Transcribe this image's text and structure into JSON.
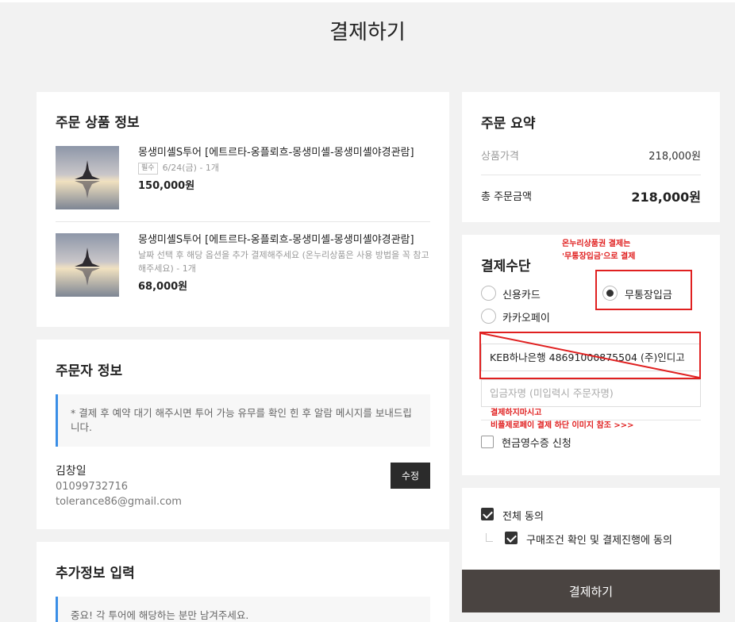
{
  "page_title": "결제하기",
  "products_card": {
    "title": "주문 상품 정보",
    "items": [
      {
        "name": "몽생미셸S투어 [에트르타-옹플뢰흐-몽생미셸-몽생미셸야경관람]",
        "badge": "필수",
        "meta": "6/24(금) - 1개",
        "price": "150,000원"
      },
      {
        "name": "몽생미셸S투어 [에트르타-옹플뢰흐-몽생미셸-몽생미셸야경관람]",
        "meta": "날짜 선택 후 해당 옵션을 추가 결제해주세요 (온누리상품은 사용 방법을 꼭 참고해주세요) - 1개",
        "price": "68,000원"
      }
    ]
  },
  "orderer_card": {
    "title": "주문자 정보",
    "notice": "* 결제 후 예약 대기 해주시면 투어 가능 유무를 확인 힌 후 알람 메시지를 보내드립니다.",
    "name": "김창일",
    "phone": "01099732716",
    "email": "tolerance86@gmail.com",
    "edit_label": "수정"
  },
  "extra_card": {
    "title": "추가정보 입력",
    "notice": "중요! 각 투어에 해당하는 분만 남겨주세요."
  },
  "summary_card": {
    "title": "주문 요약",
    "product_price_label": "상품가격",
    "product_price": "218,000원",
    "total_label": "총 주문금액",
    "total": "218,000원"
  },
  "payment_card": {
    "title": "결제수단",
    "methods": [
      {
        "label": "신용카드",
        "selected": false
      },
      {
        "label": "무통장입금",
        "selected": true
      },
      {
        "label": "카카오페이",
        "selected": false
      }
    ],
    "account_value": "KEB하나은행 48691000875504 (주)인디고",
    "depositor_placeholder": "입금자명 (미입력시 주문자명)",
    "cash_receipt_label": "현금영수증 신청",
    "annotation_top_1": "온누리상품권 결제는",
    "annotation_top_2": "'무통장입금'으로 결제",
    "annotation_bottom_1": "결제하지마시고",
    "annotation_bottom_2": "비플제로페이 결제 하단 이미지 참조 >>>"
  },
  "agreement_card": {
    "all_label": "전체 동의",
    "purchase_label": "구매조건 확인 및 결제진행에 동의"
  },
  "pay_button_label": "결제하기",
  "colors": {
    "accent_blue": "#3a8ee6",
    "annotation_red": "#e02020",
    "pay_button": "#4a4441",
    "background": "#f2f2f2"
  }
}
